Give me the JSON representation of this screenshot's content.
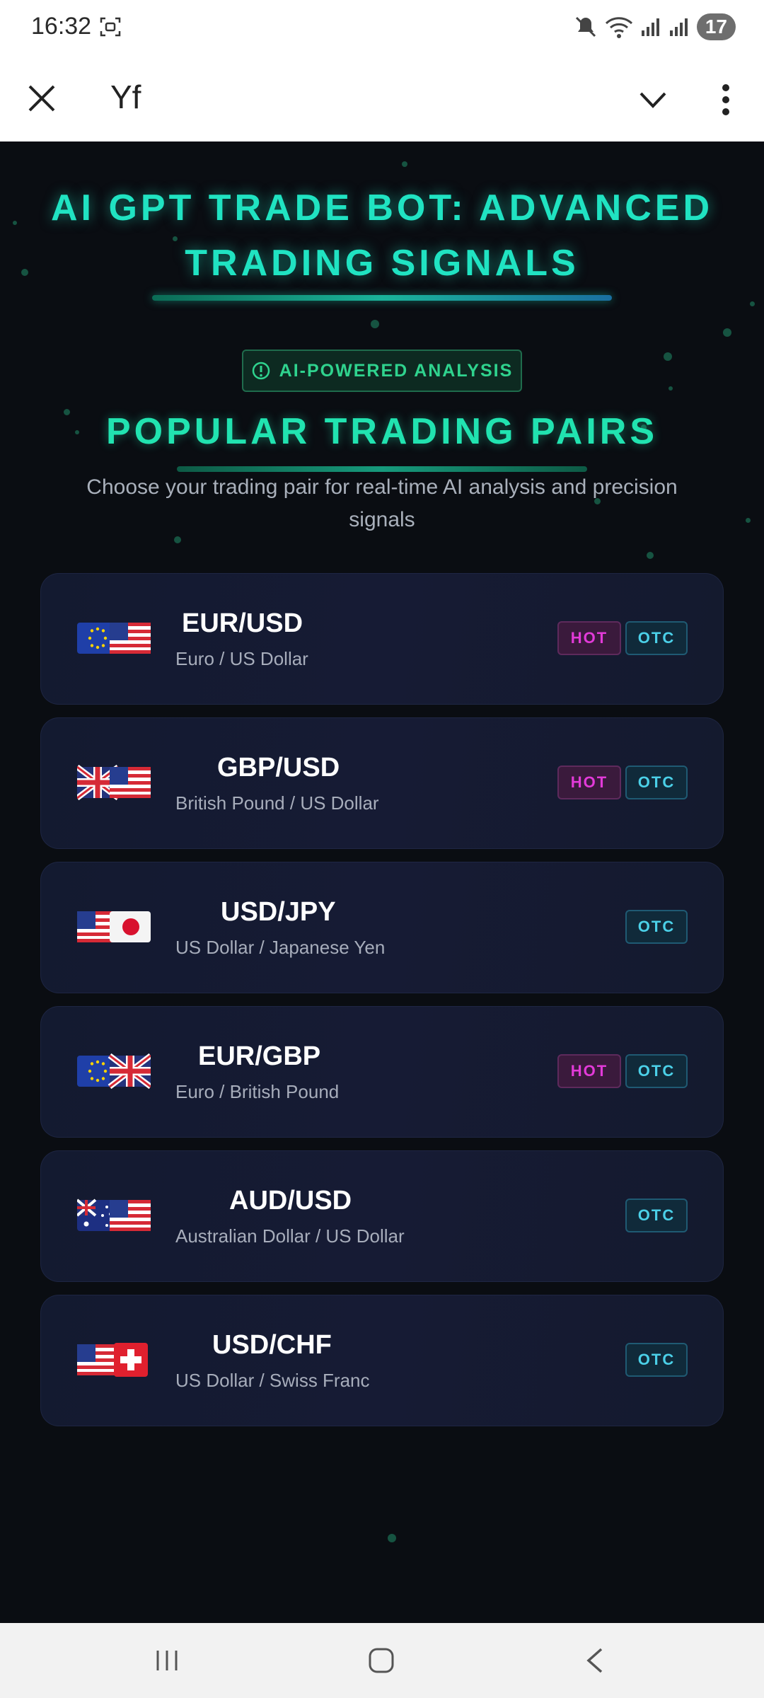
{
  "status_bar": {
    "time": "16:32",
    "battery": "17",
    "icons": [
      "screenshot-icon",
      "mute-icon",
      "wifi-icon",
      "signal-icon",
      "signal-icon"
    ]
  },
  "toolbar": {
    "close_icon": "close-icon",
    "title": "Yf",
    "dropdown_icon": "chevron-down-icon",
    "menu_icon": "more-vertical-icon"
  },
  "hero": {
    "title_line1": "AI GPT TRADE BOT: ADVANCED",
    "title_line2": "TRADING SIGNALS"
  },
  "ai_badge": {
    "icon": "info-icon",
    "label": "AI-POWERED ANALYSIS"
  },
  "section": {
    "title": "POPULAR TRADING PAIRS",
    "subtitle_line1": "Choose your trading pair for real-time AI analysis and precision",
    "subtitle_line2": "signals"
  },
  "pairs": [
    {
      "symbol": "EUR/USD",
      "name": "Euro / US Dollar",
      "flags": [
        "eu-flag",
        "us-flag"
      ],
      "hot_label": "HOT",
      "otc_label": "OTC"
    },
    {
      "symbol": "GBP/USD",
      "name": "British Pound / US Dollar",
      "flags": [
        "uk-flag",
        "us-flag"
      ],
      "hot_label": "HOT",
      "otc_label": "OTC"
    },
    {
      "symbol": "USD/JPY",
      "name": "US Dollar / Japanese Yen",
      "flags": [
        "us-flag",
        "japan-flag"
      ],
      "otc_label": "OTC"
    },
    {
      "symbol": "EUR/GBP",
      "name": "Euro / British Pound",
      "flags": [
        "eu-flag",
        "uk-flag"
      ],
      "hot_label": "HOT",
      "otc_label": "OTC"
    },
    {
      "symbol": "AUD/USD",
      "name": "Australian Dollar / US Dollar",
      "flags": [
        "australia-flag",
        "us-flag"
      ],
      "otc_label": "OTC"
    },
    {
      "symbol": "USD/CHF",
      "name": "US Dollar / Swiss Franc",
      "flags": [
        "us-flag",
        "swiss-flag"
      ],
      "otc_label": "OTC"
    }
  ],
  "nav": {
    "recent": "recent-apps-icon",
    "home": "home-icon",
    "back": "back-icon"
  },
  "colors": {
    "accent": "#20e3c2",
    "hot": "#e23ad8",
    "otc": "#4bd0e8",
    "card": "#141a30",
    "background": "#0a0d12"
  }
}
